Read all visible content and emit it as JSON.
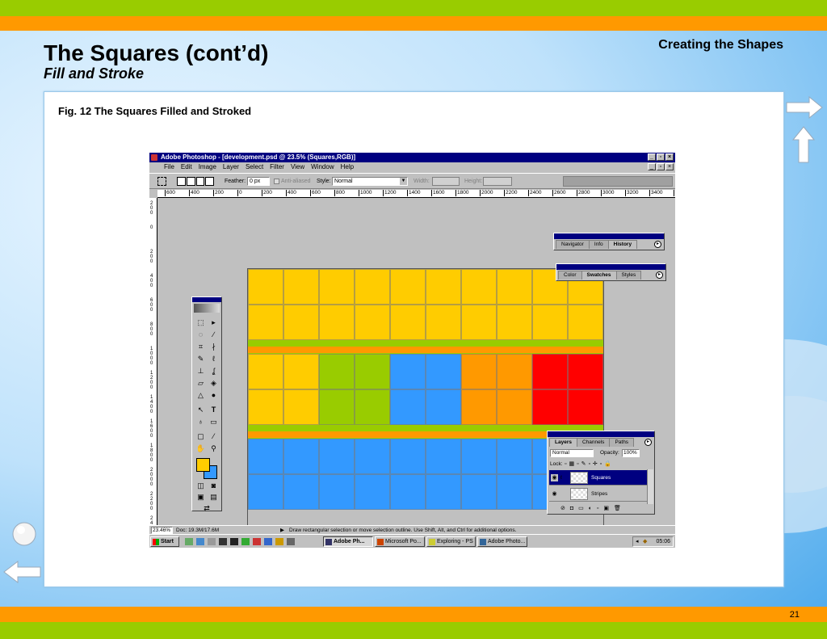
{
  "slide": {
    "title": "The Squares (cont’d)",
    "subtitle": "Fill and Stroke",
    "section": "Creating the Shapes",
    "figure_caption": "Fig. 12  The Squares Filled and Stroked",
    "page_number": "21"
  },
  "colors": {
    "green": "#99cc00",
    "orange": "#ff9900",
    "yellow": "#ffcc00",
    "blue": "#3399ff",
    "red": "#ff0000",
    "canvas_orange": "#ff9900",
    "canvas_green": "#99cc00"
  },
  "photoshop": {
    "window_title": "Adobe Photoshop - [development.psd @ 23.5% (Squares,RGB)]",
    "menus": [
      "File",
      "Edit",
      "Image",
      "Layer",
      "Select",
      "Filter",
      "View",
      "Window",
      "Help"
    ],
    "options": {
      "feather_label": "Feather:",
      "feather_value": "0 px",
      "antialiased_label": "Anti-aliased",
      "style_label": "Style:",
      "style_value": "Normal",
      "width_label": "Width:",
      "height_label": "Height:"
    },
    "ruler_h": [
      "600",
      "400",
      "200",
      "0",
      "200",
      "400",
      "600",
      "800",
      "1000",
      "1200",
      "1400",
      "1600",
      "1800",
      "2000",
      "2200",
      "2400",
      "2600",
      "2800",
      "3000",
      "3200",
      "3400",
      "3"
    ],
    "ruler_v": [
      "2 0 0",
      "0",
      "2 0 0",
      "4 0 0",
      "6 0 0",
      "8 0 0",
      "1 0 0 0",
      "1 2 0 0",
      "1 4 0 0",
      "1 6 0 0",
      "1 8 0 0",
      "2 0 0 0",
      "2 2 0 0",
      "2 4 0 0"
    ],
    "canvas_rows": [
      {
        "kind": "squares",
        "colors": [
          "yellow",
          "yellow",
          "yellow",
          "yellow",
          "yellow",
          "yellow",
          "yellow",
          "yellow",
          "yellow",
          "yellow"
        ]
      },
      {
        "kind": "squares",
        "colors": [
          "yellow",
          "yellow",
          "yellow",
          "yellow",
          "yellow",
          "yellow",
          "yellow",
          "yellow",
          "yellow",
          "yellow"
        ]
      },
      {
        "kind": "stripe"
      },
      {
        "kind": "squares",
        "colors": [
          "yellow",
          "yellow",
          "green",
          "green",
          "blue",
          "blue",
          "orange",
          "orange",
          "red",
          "red"
        ]
      },
      {
        "kind": "squares",
        "colors": [
          "yellow",
          "yellow",
          "green",
          "green",
          "blue",
          "blue",
          "orange",
          "orange",
          "red",
          "red"
        ]
      },
      {
        "kind": "stripe"
      },
      {
        "kind": "squares",
        "colors": [
          "blue",
          "blue",
          "blue",
          "blue",
          "blue",
          "blue",
          "blue",
          "blue",
          "blue",
          "blue"
        ]
      },
      {
        "kind": "squares",
        "colors": [
          "blue",
          "blue",
          "blue",
          "blue",
          "blue",
          "blue",
          "blue",
          "blue",
          "blue",
          "blue"
        ]
      }
    ],
    "palettes": {
      "history_tabs": [
        "Navigator",
        "Info",
        "History"
      ],
      "swatches_tabs": [
        "Color",
        "Swatches",
        "Styles"
      ],
      "layers_tabs": [
        "Layers",
        "Channels",
        "Paths"
      ],
      "blend_mode": "Normal",
      "opacity_label": "Opacity:",
      "opacity_value": "100%",
      "lock_label": "Lock:",
      "layers": [
        "Squares",
        "Stripes"
      ]
    },
    "status": {
      "zoom": "23.46%",
      "doc": "Doc: 19.3M/17.6M",
      "hint": "Draw rectangular selection or move selection outline. Use Shift, Alt, and Ctrl for additional options."
    },
    "taskbar": {
      "start": "Start",
      "tasks": [
        "Adobe Ph...",
        "Microsoft Po...",
        "Exploring - PS",
        "Adobe Photo..."
      ],
      "clock": "05:06"
    }
  }
}
